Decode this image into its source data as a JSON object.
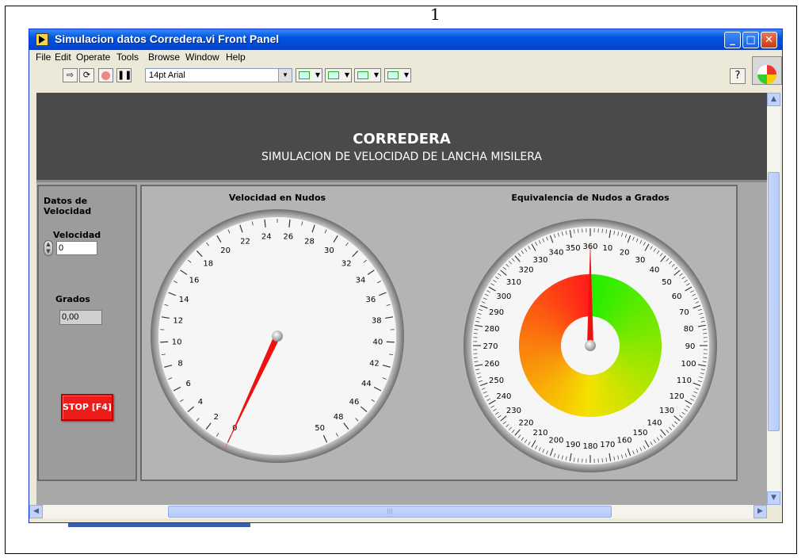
{
  "document": {
    "top_mark": "1"
  },
  "window": {
    "title": "Simulacion datos Corredera.vi Front Panel",
    "buttons": {
      "minimize": "_",
      "maximize": "□",
      "close": "✕"
    }
  },
  "menu": [
    "File",
    "Edit",
    "Operate",
    "Tools",
    "Browse",
    "Window",
    "Help"
  ],
  "toolbar": {
    "font": "14pt Arial",
    "help": "?"
  },
  "banner": {
    "title": "CORREDERA",
    "subtitle": "SIMULACION DE VELOCIDAD DE LANCHA MISILERA"
  },
  "left_panel": {
    "header": "Datos de Velocidad",
    "velocidad_label": "Velocidad",
    "velocidad_value": "0",
    "grados_label": "Grados",
    "grados_value": "0,00",
    "stop_button": "STOP [F4]"
  },
  "gauge_speed": {
    "title": "Velocidad en Nudos",
    "min": 0,
    "max": 50,
    "value": 0,
    "tick_labels": [
      "0",
      "2",
      "4",
      "6",
      "8",
      "10",
      "12",
      "14",
      "16",
      "18",
      "20",
      "22",
      "24",
      "26",
      "28",
      "30",
      "32",
      "34",
      "36",
      "38",
      "40",
      "42",
      "44",
      "46",
      "48",
      "50"
    ]
  },
  "gauge_degrees": {
    "title": "Equivalencia de Nudos a Grados",
    "min": 0,
    "max": 360,
    "value": 0,
    "tick_labels": [
      "360",
      "10",
      "20",
      "30",
      "40",
      "50",
      "60",
      "70",
      "80",
      "90",
      "100",
      "110",
      "120",
      "130",
      "140",
      "150",
      "160",
      "170",
      "180",
      "190",
      "200",
      "210",
      "220",
      "230",
      "240",
      "250",
      "260",
      "270",
      "280",
      "290",
      "300",
      "310",
      "320",
      "330",
      "340",
      "350"
    ],
    "colors": {
      "red": "#ff1a1a",
      "yellow": "#f5e100",
      "green": "#22ee00"
    }
  }
}
